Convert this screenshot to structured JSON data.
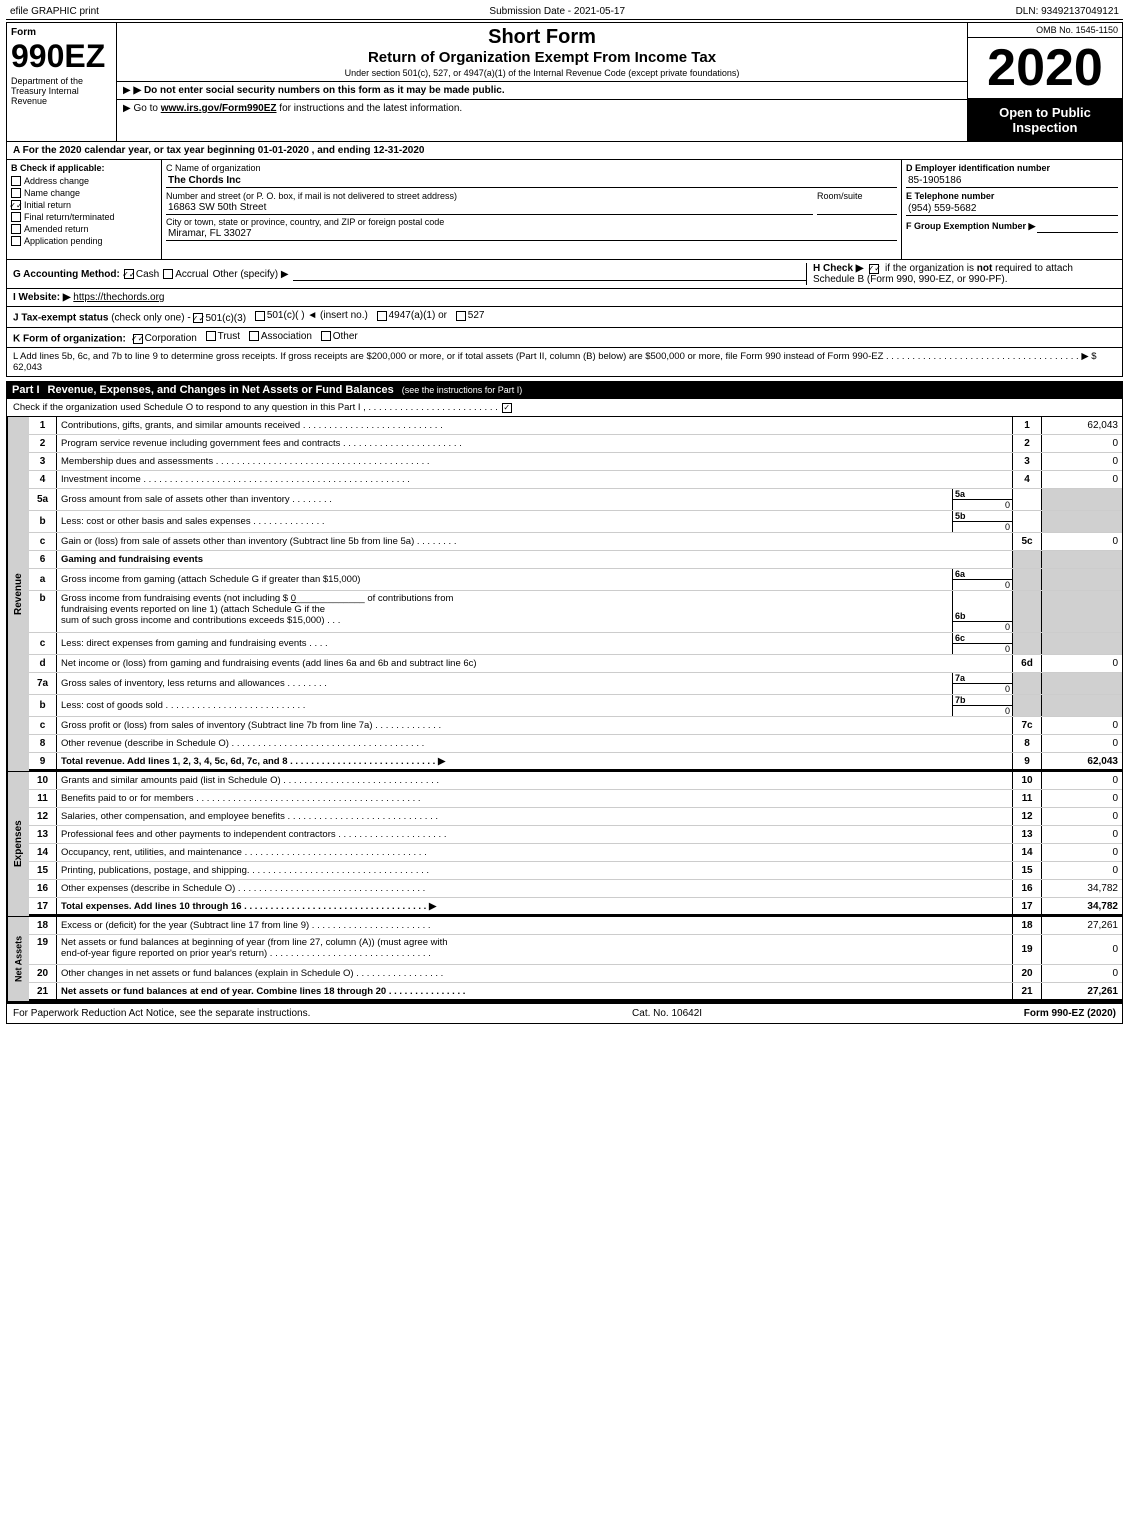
{
  "topBar": {
    "left": "efile GRAPHIC print",
    "mid": "Submission Date - 2021-05-17",
    "right": "DLN: 93492137049121"
  },
  "formNumber": "990EZ",
  "title": {
    "shortForm": "Short Form",
    "returnTitle": "Return of Organization Exempt From Income Tax",
    "subtitle": "Under section 501(c), 527, or 4947(a)(1) of the Internal Revenue Code (except private foundations)",
    "year": "2020"
  },
  "omb": "OMB No. 1545-1150",
  "openToPublic": "Open to Public Inspection",
  "dept": "Department of the Treasury Internal Revenue",
  "instruction1": "▶ Do not enter social security numbers on this form as it may be made public.",
  "instruction2": "▶ Go to www.irs.gov/Form990EZ for instructions and the latest information.",
  "yearLine": "A For the 2020 calendar year, or tax year beginning 01-01-2020 , and ending 12-31-2020",
  "checkApplicable": {
    "label": "B Check if applicable:",
    "items": [
      {
        "id": "address-change",
        "label": "Address change",
        "checked": false
      },
      {
        "id": "name-change",
        "label": "Name change",
        "checked": false
      },
      {
        "id": "initial-return",
        "label": "Initial return",
        "checked": true
      },
      {
        "id": "final-return",
        "label": "Final return/terminated",
        "checked": false
      },
      {
        "id": "amended-return",
        "label": "Amended return",
        "checked": false
      },
      {
        "id": "application-pending",
        "label": "Application pending",
        "checked": false
      }
    ]
  },
  "orgInfo": {
    "nameLabel": "C Name of organization",
    "name": "The Chords Inc",
    "addressLabel": "Number and street (or P. O. box, if mail is not delivered to street address)",
    "address": "16863 SW 50th Street",
    "roomSuiteLabel": "Room/suite",
    "roomSuite": "",
    "cityLabel": "City or town, state or province, country, and ZIP or foreign postal code",
    "city": "Miramar, FL 33027"
  },
  "ein": {
    "label": "D Employer identification number",
    "value": "85-1905186"
  },
  "phone": {
    "label": "E Telephone number",
    "value": "(954) 559-5682"
  },
  "groupExemption": {
    "label": "F Group Exemption Number ▶",
    "value": ""
  },
  "accounting": {
    "label": "G Accounting Method:",
    "cash": "Cash",
    "cashChecked": true,
    "accrual": "Accrual",
    "accrualChecked": false,
    "other": "Other (specify) ▶",
    "otherValue": ""
  },
  "hCheck": {
    "text": "H Check ▶",
    "checkChecked": true,
    "ifText": "if the organization is",
    "boldText": "not",
    "restText": "required to attach Schedule B (Form 990, 990-EZ, or 990-PF)."
  },
  "website": {
    "label": "I Website: ▶",
    "url": "https://thechords.org"
  },
  "taxStatus": {
    "label": "J Tax-exempt status",
    "note": "(check only one) -",
    "options": [
      {
        "id": "501c3",
        "label": "501(c)(3)",
        "checked": true
      },
      {
        "id": "501c",
        "label": "501(c)(  ) ◄ (insert no.)",
        "checked": false
      },
      {
        "id": "4947a1",
        "label": "4947(a)(1) or",
        "checked": false
      },
      {
        "id": "527",
        "label": "527",
        "checked": false
      }
    ]
  },
  "formOrg": {
    "label": "K Form of organization:",
    "options": [
      {
        "id": "corporation",
        "label": "Corporation",
        "checked": true
      },
      {
        "id": "trust",
        "label": "Trust",
        "checked": false
      },
      {
        "id": "association",
        "label": "Association",
        "checked": false
      },
      {
        "id": "other",
        "label": "Other",
        "checked": false
      }
    ]
  },
  "addLines": "L Add lines 5b, 6c, and 7b to line 9 to determine gross receipts. If gross receipts are $200,000 or more, or if total assets (Part II, column (B) below) are $500,000 or more, file Form 990 instead of Form 990-EZ . . . . . . . . . . . . . . . . . . . . . . . . . . . . . . . . . . . . . ▶ $ 62,043",
  "part1": {
    "label": "Part I",
    "title": "Revenue, Expenses, and Changes in Net Assets or Fund Balances",
    "titleNote": "(see the instructions for Part I)",
    "checkLine": "Check if the organization used Schedule O to respond to any question in this Part I , . . . . . . . . . . . . . . . . . . . . . . . . .",
    "rows": [
      {
        "num": "1",
        "desc": "Contributions, gifts, grants, and similar amounts received . . . . . . . . . . . . . . . . . . . . . . . . . . .",
        "lineNum": "1",
        "value": "62,043"
      },
      {
        "num": "2",
        "desc": "Program service revenue including government fees and contracts . . . . . . . . . . . . . . . . . . . . . . .",
        "lineNum": "2",
        "value": "0"
      },
      {
        "num": "3",
        "desc": "Membership dues and assessments . . . . . . . . . . . . . . . . . . . . . . . . . . . . . . . . . . . . . . . . .",
        "lineNum": "3",
        "value": "0"
      },
      {
        "num": "4",
        "desc": "Investment income . . . . . . . . . . . . . . . . . . . . . . . . . . . . . . . . . . . . . . . . . . . . . . . . . . .",
        "lineNum": "4",
        "value": "0"
      }
    ],
    "row5a": {
      "desc": "Gross amount from sale of assets other than inventory . . . . . . . .",
      "midLabel": "5a",
      "midValue": "0"
    },
    "row5b": {
      "desc": "Less: cost or other basis and sales expenses . . . . . . . . . . . . . .",
      "midLabel": "5b",
      "midValue": "0"
    },
    "row5c": {
      "desc": "Gain or (loss) from sale of assets other than inventory (Subtract line 5b from line 5a) . . . . . . . .",
      "lineNum": "5c",
      "value": "0"
    },
    "row6": {
      "desc": "Gaming and fundraising events"
    },
    "row6a": {
      "desc": "Gross income from gaming (attach Schedule G if greater than $15,000)",
      "midLabel": "6a",
      "midValue": "0"
    },
    "row6b": {
      "desc": "Gross income from fundraising events (not including $ 0_______________ of contributions from fundraising events reported on line 1) (attach Schedule G if the sum of such gross income and contributions exceeds $15,000) . . .",
      "midLabel": "6b",
      "midValue": "0"
    },
    "row6c": {
      "desc": "Less: direct expenses from gaming and fundraising events . . . .",
      "midLabel": "6c",
      "midValue": "0"
    },
    "row6d": {
      "desc": "Net income or (loss) from gaming and fundraising events (add lines 6a and 6b and subtract line 6c)",
      "lineNum": "6d",
      "value": "0"
    },
    "row7a": {
      "desc": "Gross sales of inventory, less returns and allowances . . . . . . . .",
      "midLabel": "7a",
      "midValue": "0"
    },
    "row7b": {
      "desc": "Less: cost of goods sold . . . . . . . . . . . . . . . . . . . . . . . . . . .",
      "midLabel": "7b",
      "midValue": "0"
    },
    "row7c": {
      "desc": "Gross profit or (loss) from sales of inventory (Subtract line 7b from line 7a) . . . . . . . . . . . . .",
      "lineNum": "7c",
      "value": "0"
    },
    "row8": {
      "desc": "Other revenue (describe in Schedule O) . . . . . . . . . . . . . . . . . . . . . . . . . . . . . . . . . . . . .",
      "lineNum": "8",
      "value": "0"
    },
    "row9": {
      "desc": "Total revenue. Add lines 1, 2, 3, 4, 5c, 6d, 7c, and 8 . . . . . . . . . . . . . . . . . . . . . . . . . . . . ▶",
      "lineNum": "9",
      "value": "62,043"
    }
  },
  "expenses": {
    "sectionLabel": "Expenses",
    "rows": [
      {
        "num": "10",
        "desc": "Grants and similar amounts paid (list in Schedule O) . . . . . . . . . . . . . . . . . . . . . . . . . . . . . .",
        "lineNum": "10",
        "value": "0"
      },
      {
        "num": "11",
        "desc": "Benefits paid to or for members . . . . . . . . . . . . . . . . . . . . . . . . . . . . . . . . . . . . . . . . . . .",
        "lineNum": "11",
        "value": "0"
      },
      {
        "num": "12",
        "desc": "Salaries, other compensation, and employee benefits . . . . . . . . . . . . . . . . . . . . . . . . . . . . .",
        "lineNum": "12",
        "value": "0"
      },
      {
        "num": "13",
        "desc": "Professional fees and other payments to independent contractors . . . . . . . . . . . . . . . . . . . . .",
        "lineNum": "13",
        "value": "0"
      },
      {
        "num": "14",
        "desc": "Occupancy, rent, utilities, and maintenance . . . . . . . . . . . . . . . . . . . . . . . . . . . . . . . . . . .",
        "lineNum": "14",
        "value": "0"
      },
      {
        "num": "15",
        "desc": "Printing, publications, postage, and shipping. . . . . . . . . . . . . . . . . . . . . . . . . . . . . . . . . . .",
        "lineNum": "15",
        "value": "0"
      },
      {
        "num": "16",
        "desc": "Other expenses (describe in Schedule O) . . . . . . . . . . . . . . . . . . . . . . . . . . . . . . . . . . . .",
        "lineNum": "16",
        "value": "34,782"
      },
      {
        "num": "17",
        "desc": "Total expenses. Add lines 10 through 16 . . . . . . . . . . . . . . . . . . . . . . . . . . . . . . . . . . . ▶",
        "lineNum": "17",
        "value": "34,782",
        "bold": true
      }
    ]
  },
  "netAssets": {
    "sectionLabel": "Net Assets",
    "rows": [
      {
        "num": "18",
        "desc": "Excess or (deficit) for the year (Subtract line 17 from line 9) . . . . . . . . . . . . . . . . . . . . . . .",
        "lineNum": "18",
        "value": "27,261"
      },
      {
        "num": "19",
        "desc": "Net assets or fund balances at beginning of year (from line 27, column (A)) (must agree with end-of-year figure reported on prior year's return) . . . . . . . . . . . . . . . . . . . . . . . . . . . . . . .",
        "lineNum": "19",
        "value": "0"
      },
      {
        "num": "20",
        "desc": "Other changes in net assets or fund balances (explain in Schedule O) . . . . . . . . . . . . . . . . .",
        "lineNum": "20",
        "value": "0"
      },
      {
        "num": "21",
        "desc": "Net assets or fund balances at end of year. Combine lines 18 through 20 . . . . . . . . . . . . . . .",
        "lineNum": "21",
        "value": "27,261",
        "bold": true
      }
    ]
  },
  "footer": {
    "left": "For Paperwork Reduction Act Notice, see the separate instructions.",
    "mid": "Cat. No. 10642I",
    "right": "Form 990-EZ (2020)"
  }
}
